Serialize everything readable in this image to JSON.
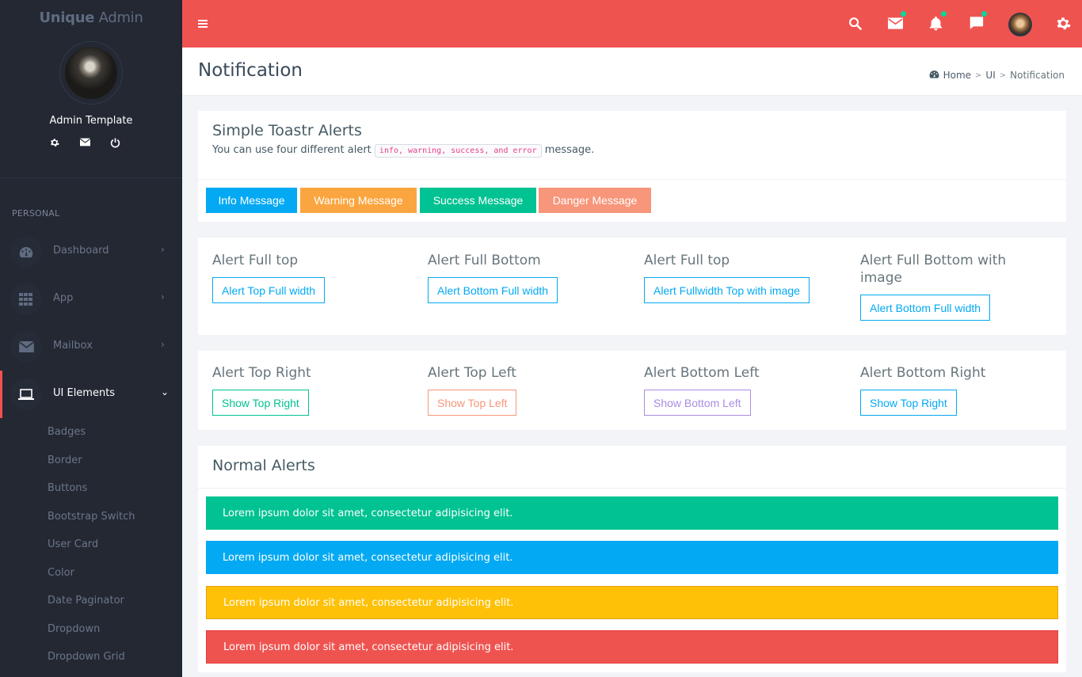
{
  "sidebar": {
    "logo_bold": "Unique",
    "logo_light": "Admin",
    "user_name": "Admin Template",
    "user_icons": [
      "gear-icon",
      "mail-icon",
      "power-icon"
    ],
    "section_label": "PERSONAL",
    "menu": [
      {
        "label": "Dashboard",
        "icon": "dashboard-icon",
        "chevron": ">"
      },
      {
        "label": "App",
        "icon": "grid-icon",
        "chevron": ">"
      },
      {
        "label": "Mailbox",
        "icon": "envelope-icon",
        "chevron": ">"
      },
      {
        "label": "UI Elements",
        "icon": "laptop-icon",
        "chevron": "v",
        "active": true
      }
    ],
    "submenu": [
      "Badges",
      "Border",
      "Buttons",
      "Bootstrap Switch",
      "User Card",
      "Color",
      "Date Paginator",
      "Dropdown",
      "Dropdown Grid"
    ]
  },
  "topbar": {
    "icons": [
      "search-icon",
      "mail-icon",
      "bell-icon",
      "chat-icon",
      "user-avatar",
      "gear-icon"
    ],
    "accent_color": "#ef5350",
    "badge_color": "#06d79c"
  },
  "page": {
    "title": "Notification",
    "breadcrumb": [
      "Home",
      "UI",
      "Notification"
    ]
  },
  "toastr": {
    "title": "Simple Toastr Alerts",
    "hint_before": "You can use four different alert",
    "hint_code": "info, warning, success, and error",
    "hint_after": "message.",
    "buttons": [
      {
        "label": "Info Message",
        "color": "#03a9f3"
      },
      {
        "label": "Warning Message",
        "color": "#fba540"
      },
      {
        "label": "Success Message",
        "color": "#00c292"
      },
      {
        "label": "Danger Message",
        "color": "#f7967a"
      }
    ]
  },
  "full_alerts": [
    {
      "title": "Alert Full top",
      "button": "Alert Top Full width"
    },
    {
      "title": "Alert Full Bottom",
      "button": "Alert Bottom Full width"
    },
    {
      "title": "Alert Full top",
      "button": "Alert Fullwidth Top with image"
    },
    {
      "title": "Alert Full Bottom with image",
      "button": "Alert Bottom Full width"
    }
  ],
  "position_alerts": [
    {
      "title": "Alert Top Right",
      "button": "Show Top Right",
      "color": "#00c292"
    },
    {
      "title": "Alert Top Left",
      "button": "Show Top Left",
      "color": "#f7967a"
    },
    {
      "title": "Alert Bottom Left",
      "button": "Show Bottom Left",
      "color": "#ab8ce4"
    },
    {
      "title": "Alert Bottom Right",
      "button": "Show Top Right",
      "color": "#03a9f3"
    }
  ],
  "normal_alerts": {
    "title": "Normal Alerts",
    "items": [
      {
        "text": "Lorem ipsum dolor sit amet, consectetur adipisicing elit.",
        "color": "#00c292"
      },
      {
        "text": "Lorem ipsum dolor sit amet, consectetur adipisicing elit.",
        "color": "#03a9f3"
      },
      {
        "text": "Lorem ipsum dolor sit amet, consectetur adipisicing elit.",
        "color": "#fec107"
      },
      {
        "text": "Lorem ipsum dolor sit amet, consectetur adipisicing elit.",
        "color": "#ef5350"
      }
    ]
  }
}
